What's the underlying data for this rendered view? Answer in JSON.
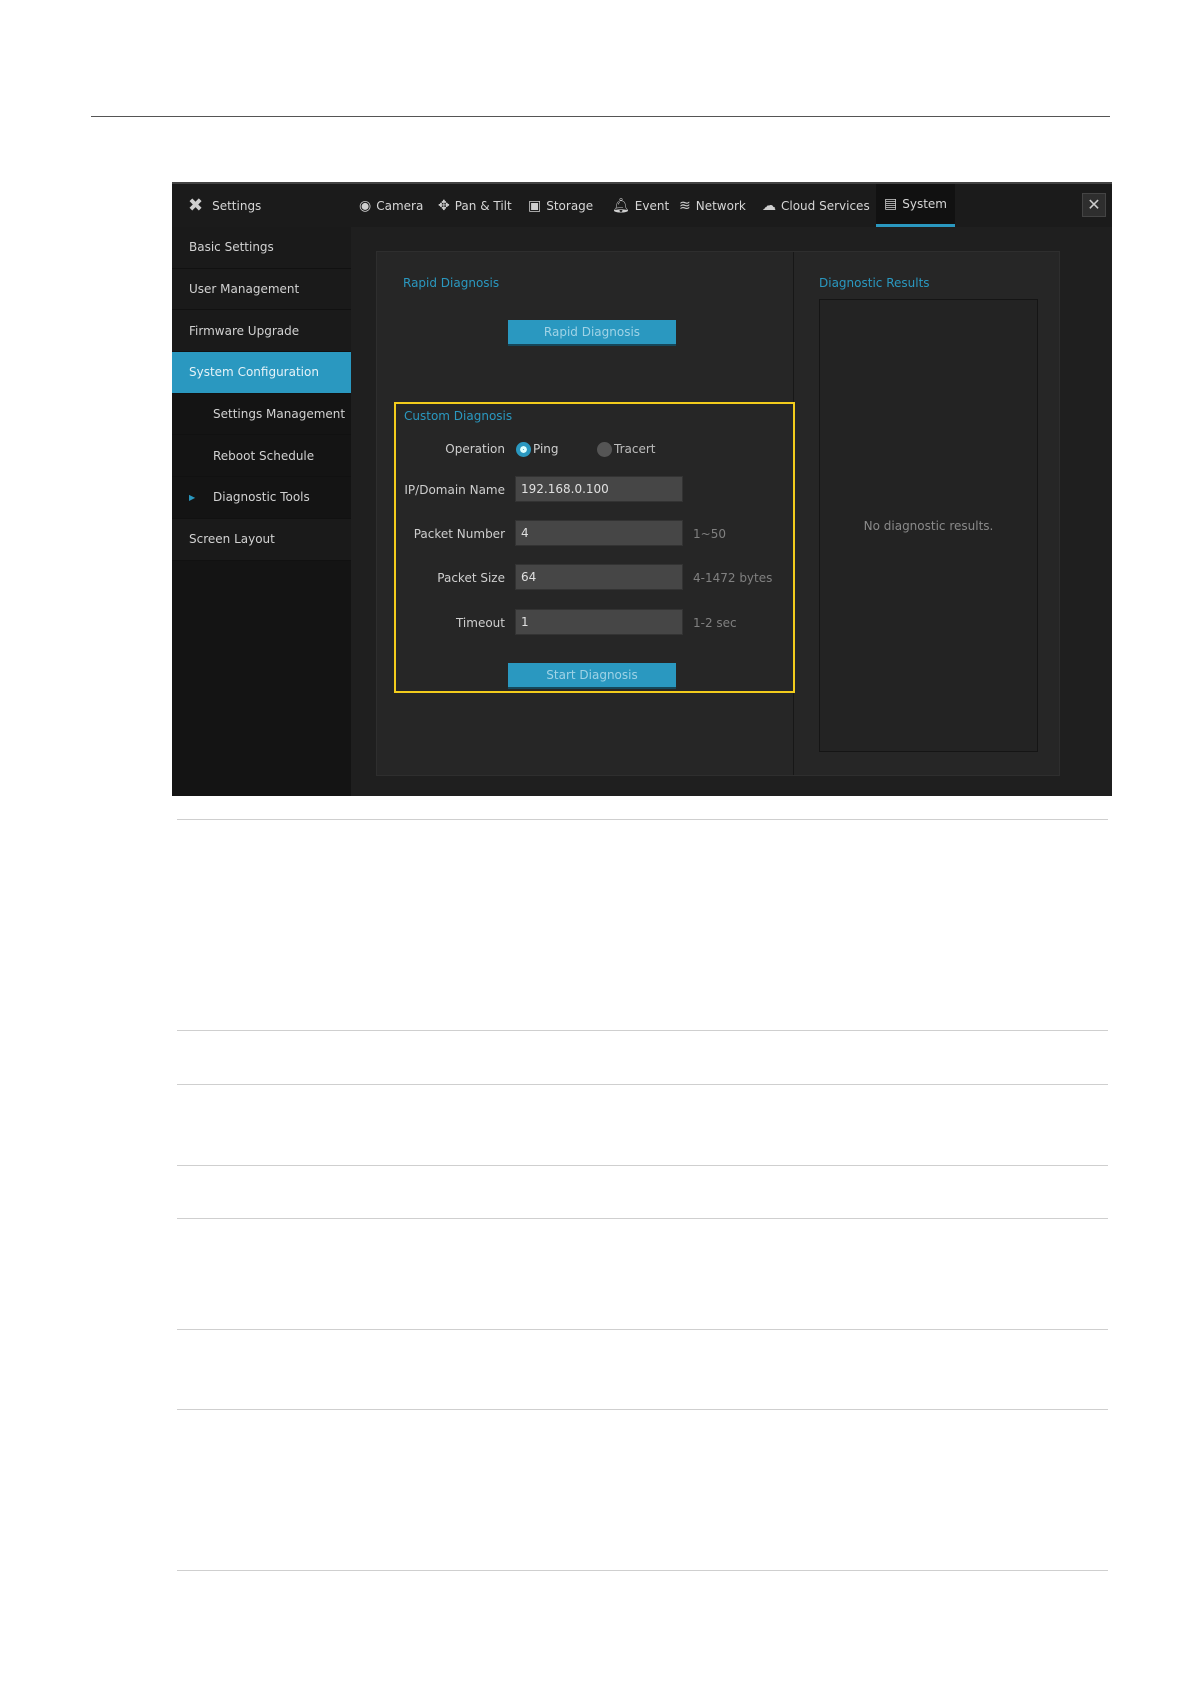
{
  "header": {
    "settings_label": "Settings",
    "tabs": [
      {
        "label": "Camera",
        "icon": "camera-icon"
      },
      {
        "label": "Pan & Tilt",
        "icon": "pan-tilt-icon"
      },
      {
        "label": "Storage",
        "icon": "storage-icon"
      },
      {
        "label": "Event",
        "icon": "bell-icon"
      },
      {
        "label": "Network",
        "icon": "wifi-icon"
      },
      {
        "label": "Cloud Services",
        "icon": "cloud-icon"
      },
      {
        "label": "System",
        "icon": "monitor-icon",
        "active": true
      }
    ],
    "close": "✕"
  },
  "sidebar": {
    "items": [
      {
        "label": "Basic Settings"
      },
      {
        "label": "User Management"
      },
      {
        "label": "Firmware Upgrade"
      },
      {
        "label": "System Configuration",
        "active": true
      },
      {
        "label": "Settings Management",
        "sub": true
      },
      {
        "label": "Reboot Schedule",
        "sub": true
      },
      {
        "label": "Diagnostic Tools",
        "sub": true,
        "current": true
      },
      {
        "label": "Screen Layout"
      }
    ]
  },
  "rapid": {
    "title": "Rapid Diagnosis",
    "button": "Rapid Diagnosis"
  },
  "custom": {
    "title": "Custom Diagnosis",
    "operation_label": "Operation",
    "options": [
      "Ping",
      "Tracert"
    ],
    "selected": "Ping",
    "fields": [
      {
        "label": "IP/Domain Name",
        "value": "192.168.0.100",
        "hint": ""
      },
      {
        "label": "Packet Number",
        "value": "4",
        "hint": "1~50"
      },
      {
        "label": "Packet Size",
        "value": "64",
        "hint": "4-1472 bytes"
      },
      {
        "label": "Timeout",
        "value": "1",
        "hint": "1-2 sec"
      }
    ],
    "button": "Start Diagnosis"
  },
  "results": {
    "title": "Diagnostic Results",
    "empty": "No diagnostic results."
  },
  "colors": {
    "accent": "#2a98c0",
    "highlight": "#f2cc1c"
  }
}
